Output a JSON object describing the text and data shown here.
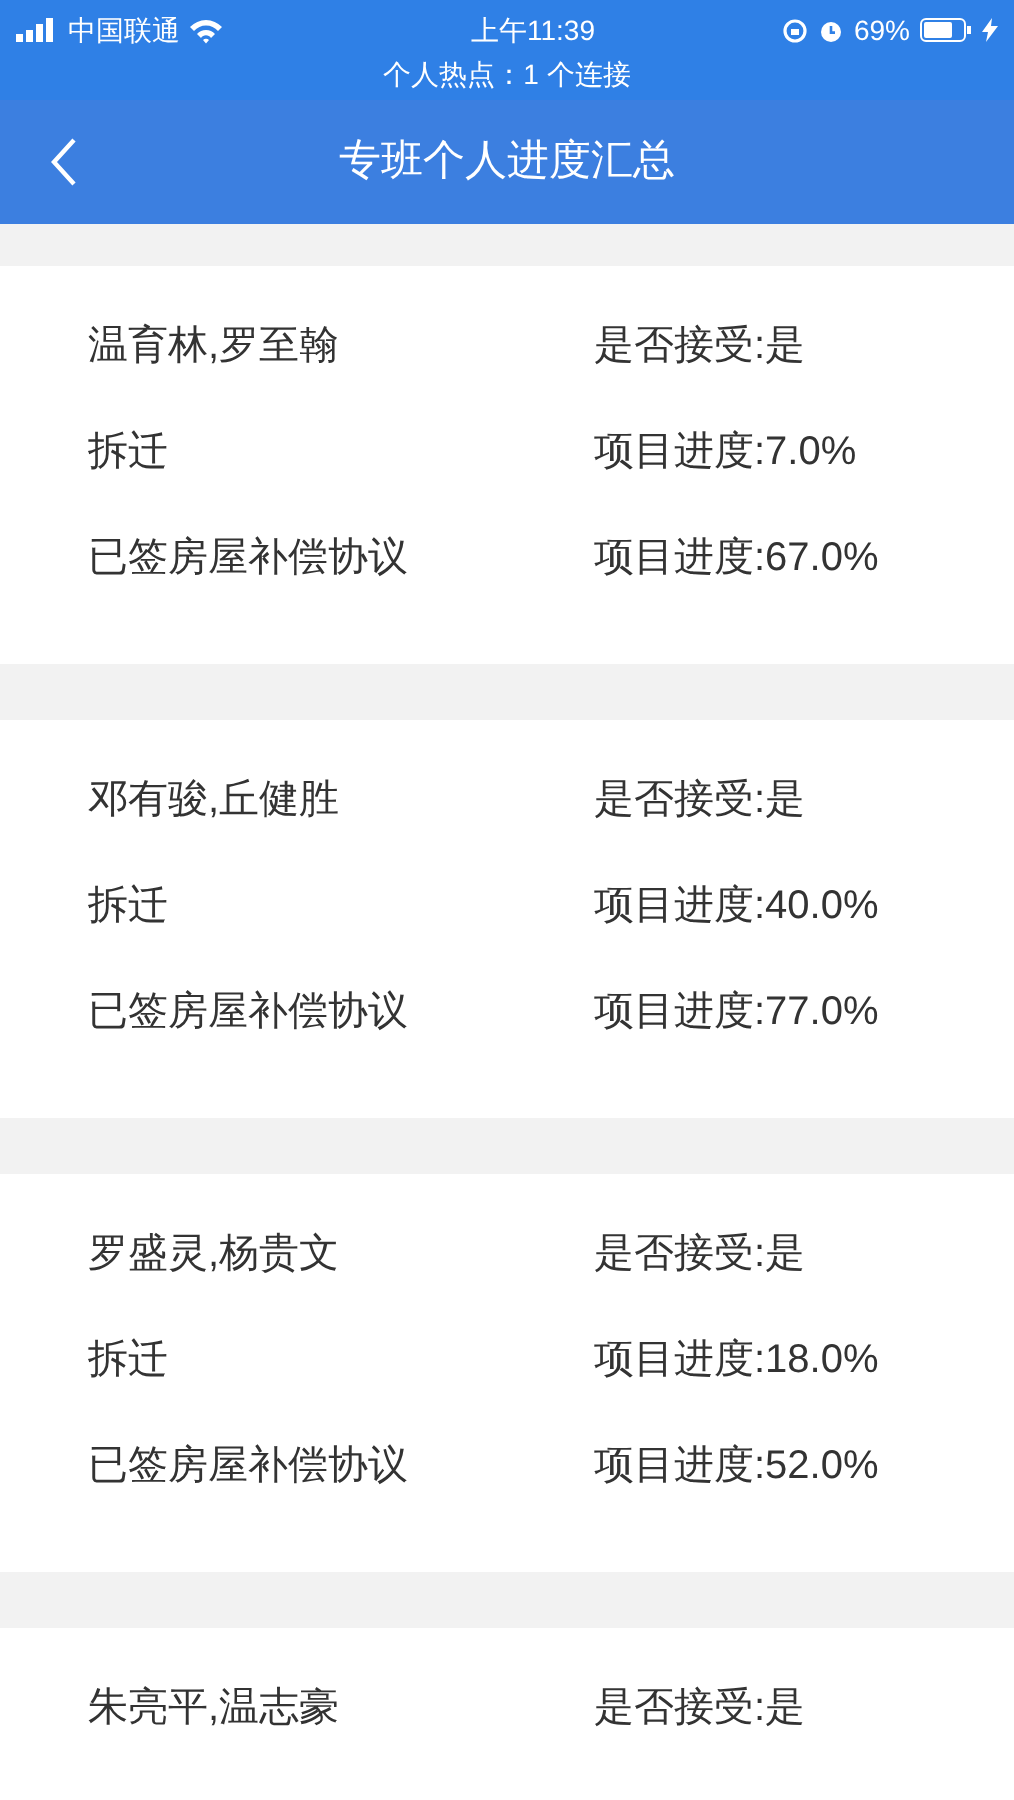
{
  "status_bar": {
    "carrier": "中国联通",
    "time": "上午11:39",
    "battery": "69%",
    "hotspot": "个人热点：1 个连接"
  },
  "header": {
    "title": "专班个人进度汇总"
  },
  "cards": [
    {
      "rows": [
        {
          "left": "温育林,罗至翰",
          "right": "是否接受:是"
        },
        {
          "left": "拆迁",
          "right": "项目进度:7.0%"
        },
        {
          "left": "已签房屋补偿协议",
          "right": "项目进度:67.0%"
        }
      ]
    },
    {
      "rows": [
        {
          "left": "邓有骏,丘健胜",
          "right": "是否接受:是"
        },
        {
          "left": "拆迁",
          "right": "项目进度:40.0%"
        },
        {
          "left": "已签房屋补偿协议",
          "right": "项目进度:77.0%"
        }
      ]
    },
    {
      "rows": [
        {
          "left": "罗盛灵,杨贵文",
          "right": "是否接受:是"
        },
        {
          "left": "拆迁",
          "right": "项目进度:18.0%"
        },
        {
          "left": "已签房屋补偿协议",
          "right": "项目进度:52.0%"
        }
      ]
    },
    {
      "rows": [
        {
          "left": "朱亮平,温志豪",
          "right": "是否接受:是"
        }
      ]
    }
  ]
}
